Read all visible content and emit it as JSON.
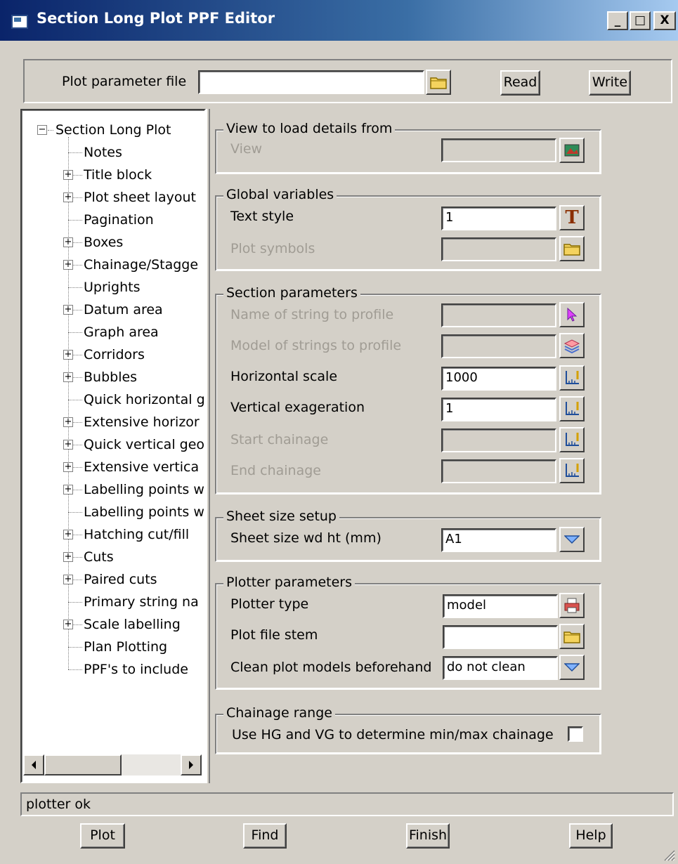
{
  "window": {
    "title": "Section Long Plot PPF Editor",
    "controls": {
      "minimize": "_",
      "maximize": "□",
      "close": "X"
    }
  },
  "top": {
    "ppf_label": "Plot parameter file",
    "ppf_value": "",
    "read_label": "Read",
    "write_label": "Write"
  },
  "tree": {
    "root": "Section Long Plot",
    "items": [
      {
        "label": "Notes",
        "expandable": false
      },
      {
        "label": "Title block",
        "expandable": true
      },
      {
        "label": "Plot sheet layout",
        "expandable": true
      },
      {
        "label": "Pagination",
        "expandable": false
      },
      {
        "label": "Boxes",
        "expandable": true
      },
      {
        "label": "Chainage/Stagge",
        "expandable": true
      },
      {
        "label": "Uprights",
        "expandable": false
      },
      {
        "label": "Datum area",
        "expandable": true
      },
      {
        "label": "Graph area",
        "expandable": false
      },
      {
        "label": "Corridors",
        "expandable": true
      },
      {
        "label": "Bubbles",
        "expandable": true
      },
      {
        "label": "Quick horizontal g",
        "expandable": false
      },
      {
        "label": "Extensive horizor",
        "expandable": true
      },
      {
        "label": "Quick vertical geo",
        "expandable": true
      },
      {
        "label": "Extensive vertica",
        "expandable": true
      },
      {
        "label": "Labelling points w",
        "expandable": true
      },
      {
        "label": "Labelling points w",
        "expandable": false
      },
      {
        "label": "Hatching cut/fill",
        "expandable": true
      },
      {
        "label": "Cuts",
        "expandable": true
      },
      {
        "label": "Paired cuts",
        "expandable": true
      },
      {
        "label": "Primary string na",
        "expandable": false
      },
      {
        "label": "Scale labelling",
        "expandable": true
      },
      {
        "label": "Plan Plotting",
        "expandable": false
      },
      {
        "label": "PPF's to include",
        "expandable": false
      }
    ]
  },
  "groups": {
    "view": {
      "title": "View to load details from",
      "view_label": "View",
      "view_value": ""
    },
    "global": {
      "title": "Global variables",
      "text_style_label": "Text style",
      "text_style_value": "1",
      "plot_symbols_label": "Plot symbols",
      "plot_symbols_value": ""
    },
    "section": {
      "title": "Section parameters",
      "name_label": "Name of string to profile",
      "name_value": "",
      "model_label": "Model of strings to profile",
      "model_value": "",
      "hscale_label": "Horizontal scale",
      "hscale_value": "1000",
      "vexag_label": "Vertical exageration",
      "vexag_value": "1",
      "start_label": "Start chainage",
      "start_value": "",
      "end_label": "End chainage",
      "end_value": ""
    },
    "sheet": {
      "title": "Sheet size setup",
      "size_label": "Sheet size wd ht (mm)",
      "size_value": "A1"
    },
    "plotter": {
      "title": "Plotter parameters",
      "type_label": "Plotter type",
      "type_value": "model",
      "stem_label": "Plot file stem",
      "stem_value": "",
      "clean_label": "Clean plot models beforehand",
      "clean_value": "do not clean"
    },
    "chainage": {
      "title": "Chainage range",
      "use_label": "Use HG and VG to determine min/max chainage",
      "use_checked": false
    }
  },
  "status": {
    "message": "plotter ok"
  },
  "bottom": {
    "plot_label": "Plot",
    "find_label": "Find",
    "finish_label": "Finish",
    "help_label": "Help"
  },
  "colors": {
    "dialog_bg": "#d4d0c8",
    "titlebar_start": "#0a246a",
    "titlebar_end": "#a6caf0",
    "disabled_text": "#a09c94"
  }
}
